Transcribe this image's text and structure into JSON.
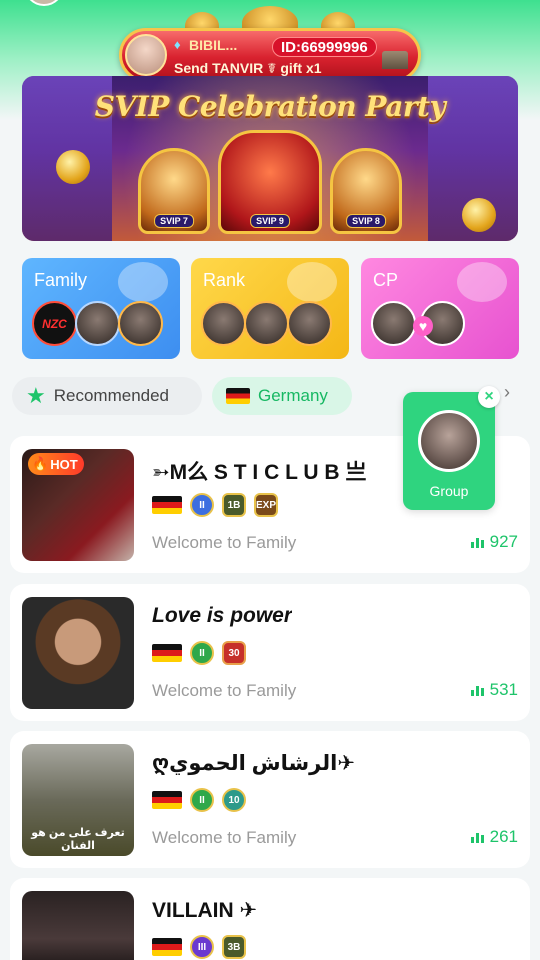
{
  "gift_notice": {
    "sender": "BIBIL...",
    "id_label": "ID:66999996",
    "message": "Send TANVIR ☤ gift x1"
  },
  "hero_banner": {
    "title": "SVIP Celebration Party",
    "badges": [
      "SVIP 7",
      "SVIP 9",
      "SVIP 8"
    ]
  },
  "categories": [
    {
      "label": "Family"
    },
    {
      "label": "Rank"
    },
    {
      "label": "CP"
    }
  ],
  "family_card": {
    "logo_text": "NZC"
  },
  "filters": {
    "recommended": "Recommended",
    "country": "Germany"
  },
  "floating_widget": {
    "label": "Group",
    "close": "×"
  },
  "families": [
    {
      "name": "➳M么 S T I C L U B 亗",
      "badges": [
        "II",
        "1B",
        "EXP"
      ],
      "description": "Welcome to Family",
      "count": "927",
      "hot_label": "HOT"
    },
    {
      "name": "Love is power",
      "badges": [
        "II",
        "30"
      ],
      "description": "Welcome to Family",
      "count": "531"
    },
    {
      "name": "ღالرشاش الحموي✈",
      "badges": [
        "II",
        "10"
      ],
      "description": "Welcome to Family",
      "count": "261",
      "photo_caption": "تعرف على من هو الفنان"
    },
    {
      "name": "VILLAIN ✈",
      "badges": [
        "III",
        "3B"
      ]
    }
  ],
  "colors": {
    "accent_green": "#1ec46a",
    "family_blue": "#3d8ef0",
    "rank_yellow": "#f4b716",
    "cp_pink": "#e752d0"
  }
}
